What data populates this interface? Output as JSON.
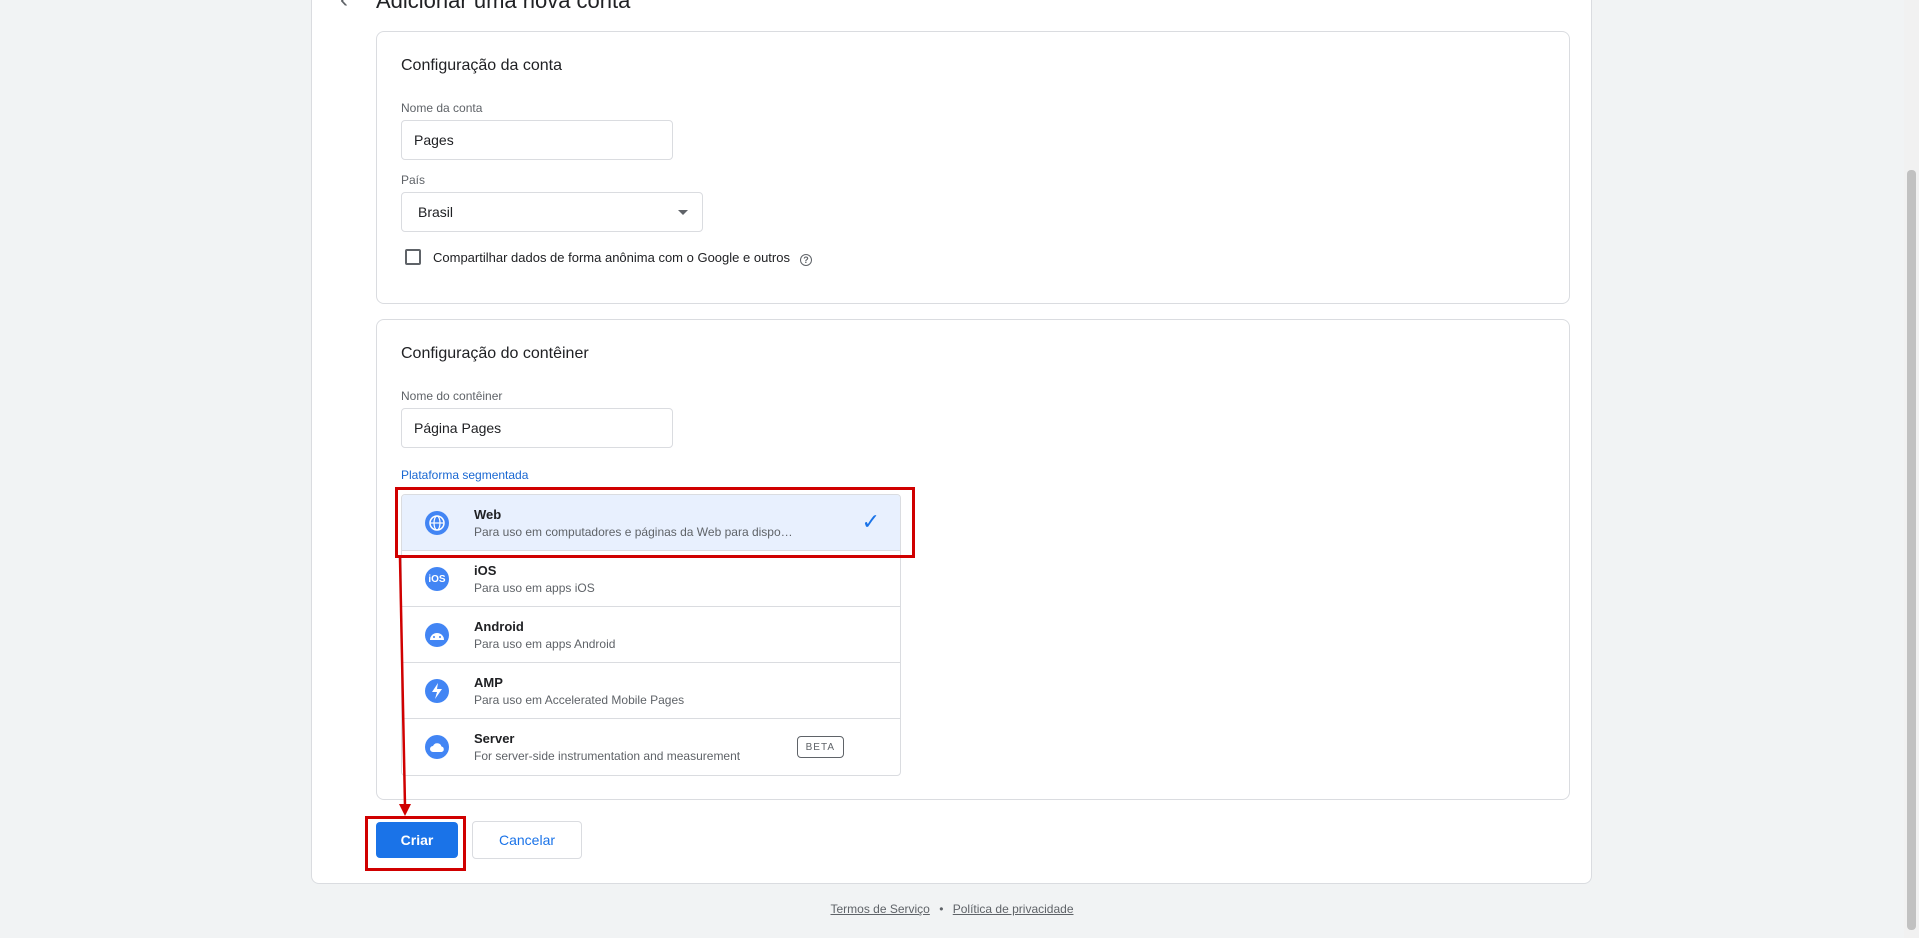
{
  "header": {
    "title": "Adicionar uma nova conta"
  },
  "account_section": {
    "title": "Configuração da conta",
    "name_label": "Nome da conta",
    "name_value": "Pages",
    "country_label": "País",
    "country_value": "Brasil",
    "share_data_label": "Compartilhar dados de forma anônima com o Google e outros",
    "share_data_checked": false
  },
  "container_section": {
    "title": "Configuração do contêiner",
    "name_label": "Nome do contêiner",
    "name_value": "Página Pages",
    "platform_label": "Plataforma segmentada",
    "platforms": [
      {
        "name": "Web",
        "desc": "Para uso em computadores e páginas da Web para dispositivos móveis",
        "icon": "globe-icon",
        "selected": true
      },
      {
        "name": "iOS",
        "desc": "Para uso em apps iOS",
        "icon": "ios-icon",
        "selected": false
      },
      {
        "name": "Android",
        "desc": "Para uso em apps Android",
        "icon": "android-icon",
        "selected": false
      },
      {
        "name": "AMP",
        "desc": "Para uso em Accelerated Mobile Pages",
        "icon": "bolt-icon",
        "selected": false
      },
      {
        "name": "Server",
        "desc": "For server-side instrumentation and measurement",
        "icon": "cloud-icon",
        "selected": false,
        "badge": "BETA"
      }
    ]
  },
  "actions": {
    "create_label": "Criar",
    "cancel_label": "Cancelar"
  },
  "footer": {
    "terms": "Termos de Serviço",
    "separator": "•",
    "privacy": "Política de privacidade"
  },
  "colors": {
    "primary": "#1a73e8",
    "selected_bg": "#e8f0fe",
    "annotation": "#d00000"
  }
}
